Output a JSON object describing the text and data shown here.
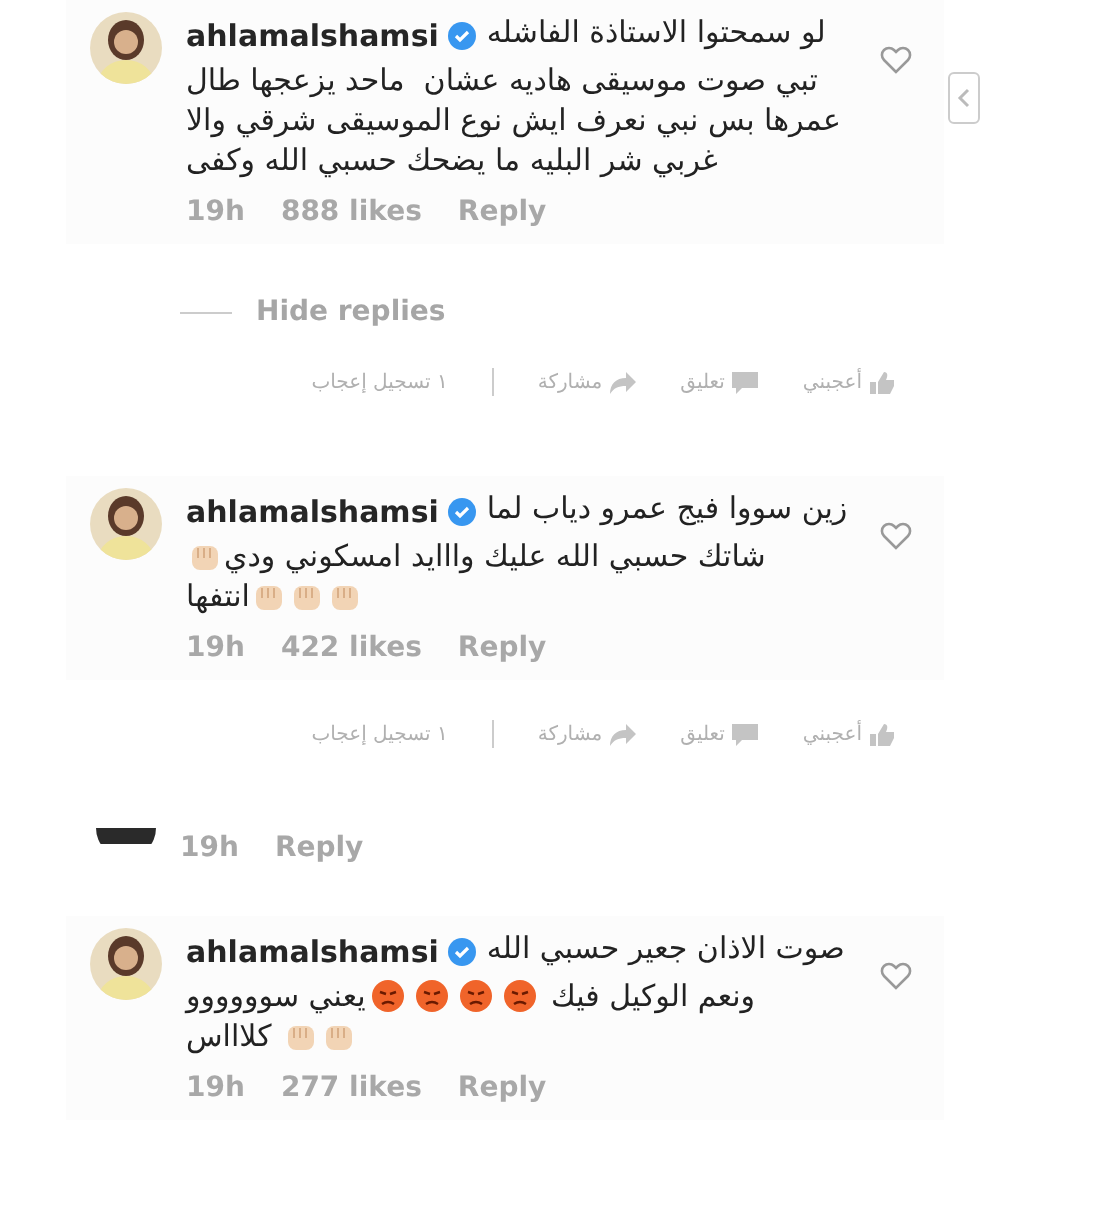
{
  "sections": [
    {
      "kind": "comment",
      "username": "ahlamalshamsi",
      "verified": true,
      "side_arrow": true,
      "lines": [
        [
          {
            "kind": "text",
            "text": "لو سمحتوا الاستاذة الفاشله"
          }
        ],
        [
          {
            "kind": "text",
            "text": "تبي صوت موسيقى هاديه عشان  ماحد يزعجها طال"
          }
        ],
        [
          {
            "kind": "text",
            "text": "عمرها بس نبي نعرف ايش نوع الموسيقى شرقي والا"
          }
        ],
        [
          {
            "kind": "text",
            "text": "غربي شر البليه ما يضحك حسبي الله وكفى"
          }
        ]
      ],
      "time": "19h",
      "likes": "888 likes",
      "reply": "Reply"
    },
    {
      "kind": "hide_replies",
      "label": "Hide replies"
    },
    {
      "kind": "fb_bar",
      "like": "أعجبني",
      "comment": "تعليق",
      "share": "مشاركة",
      "count": "١ تسجيل إعجاب"
    },
    {
      "kind": "comment",
      "username": "ahlamalshamsi",
      "verified": true,
      "side_arrow": false,
      "lines": [
        [
          {
            "kind": "text",
            "text": "زين سووا فيج عمرو دياب لما"
          }
        ],
        [
          {
            "kind": "text",
            "text": "شاتك حسبي الله عليك وااايد امسكوني ودي"
          },
          {
            "kind": "fist"
          }
        ],
        [
          {
            "kind": "fist"
          },
          {
            "kind": "fist"
          },
          {
            "kind": "fist"
          },
          {
            "kind": "text",
            "text": "انتفها"
          }
        ]
      ],
      "time": "19h",
      "likes": "422 likes",
      "reply": "Reply"
    },
    {
      "kind": "fb_bar",
      "like": "أعجبني",
      "comment": "تعليق",
      "share": "مشاركة",
      "count": "١ تسجيل إعجاب"
    },
    {
      "kind": "reply_stub",
      "time": "19h",
      "reply": "Reply"
    },
    {
      "kind": "comment",
      "username": "ahlamalshamsi",
      "verified": true,
      "side_arrow": false,
      "lines": [
        [
          {
            "kind": "text",
            "text": "صوت الاذان جعير حسبي الله"
          }
        ],
        [
          {
            "kind": "text",
            "text": "ونعم الوكيل فيك "
          },
          {
            "kind": "angry"
          },
          {
            "kind": "angry"
          },
          {
            "kind": "angry"
          },
          {
            "kind": "angry"
          },
          {
            "kind": "text",
            "text": "يعني سوووووو"
          }
        ],
        [
          {
            "kind": "fist"
          },
          {
            "kind": "fist"
          },
          {
            "kind": "text",
            "text": " كلاااس"
          }
        ]
      ],
      "time": "19h",
      "likes": "277 likes",
      "reply": "Reply"
    }
  ]
}
